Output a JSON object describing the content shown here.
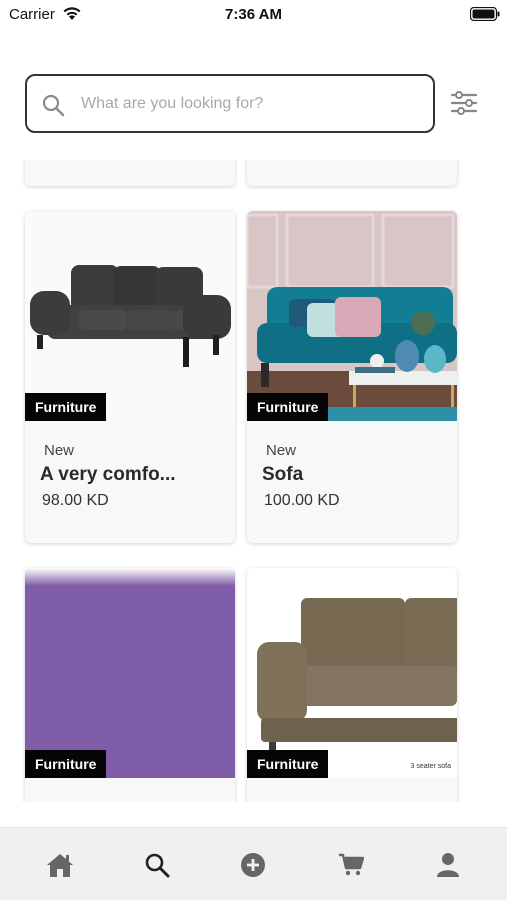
{
  "status_bar": {
    "carrier": "Carrier",
    "time": "7:36 AM",
    "icons": [
      "wifi-icon",
      "battery-icon"
    ]
  },
  "search": {
    "placeholder": "What are you looking for?",
    "value": "",
    "icon": "search-icon",
    "filter_icon": "sliders-icon"
  },
  "products": [
    {
      "category": "Furniture",
      "condition": "New",
      "name": "A very comfo...",
      "price": "98.00 KD",
      "image": "dark-grey-three-seat-sofa"
    },
    {
      "category": "Furniture",
      "condition": "New",
      "name": "Sofa",
      "price": "100.00 KD",
      "image": "teal-sofa-living-room"
    },
    {
      "category": "Furniture",
      "condition": "",
      "name": "",
      "price": "",
      "image": "purple-placeholder"
    },
    {
      "category": "Furniture",
      "condition": "",
      "name": "",
      "price": "",
      "image": "brown-three-seater-sofa",
      "image_caption": "3 seater sofa"
    }
  ],
  "colors": {
    "accent": "#050505",
    "placeholder_purple": "#7f5da8",
    "tab_bar_bg": "#f0f0f0",
    "active_tab": "#222222",
    "inactive_tab": "#666666"
  },
  "tab_bar": {
    "active": "search",
    "tabs": [
      {
        "id": "home",
        "icon": "home-icon"
      },
      {
        "id": "search",
        "icon": "search-icon"
      },
      {
        "id": "add",
        "icon": "plus-circle-icon"
      },
      {
        "id": "cart",
        "icon": "cart-icon"
      },
      {
        "id": "profile",
        "icon": "user-icon"
      }
    ]
  }
}
